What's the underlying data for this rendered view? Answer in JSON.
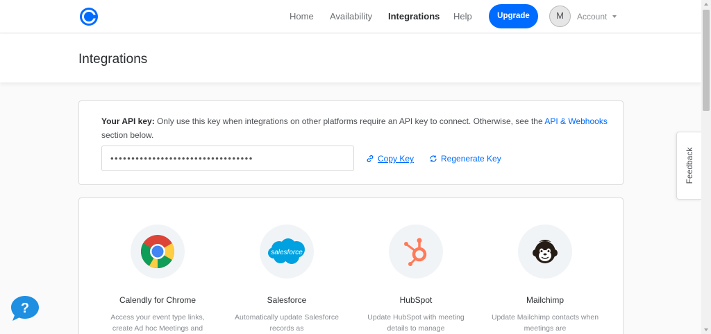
{
  "nav": {
    "links": [
      {
        "label": "Home",
        "active": false
      },
      {
        "label": "Availability",
        "active": false
      },
      {
        "label": "Integrations",
        "active": true
      },
      {
        "label": "Help",
        "active": false
      }
    ],
    "upgrade_label": "Upgrade",
    "avatar_initial": "M",
    "account_label": "Account"
  },
  "page": {
    "title": "Integrations"
  },
  "api": {
    "label": "Your API key:",
    "text_before_link": " Only use this key when integrations on other platforms require an API key to connect. Otherwise, see the ",
    "link_text": "API & Webhooks",
    "text_after_link": " section below.",
    "key_masked": "••••••••••••••••••••••••••••••••••",
    "copy_label": "Copy Key",
    "regenerate_label": "Regenerate Key"
  },
  "integrations": [
    {
      "name": "Calendly for Chrome",
      "desc": "Access your event type links, create Ad hoc Meetings and",
      "icon": "chrome-icon"
    },
    {
      "name": "Salesforce",
      "desc": "Automatically update Salesforce records as",
      "icon": "salesforce-icon",
      "logo_text": "salesforce"
    },
    {
      "name": "HubSpot",
      "desc": "Update HubSpot with meeting details to manage",
      "icon": "hubspot-icon"
    },
    {
      "name": "Mailchimp",
      "desc": "Update Mailchimp contacts when meetings are",
      "icon": "mailchimp-icon"
    }
  ],
  "feedback_label": "Feedback",
  "help_bubble_label": "?",
  "colors": {
    "brand_blue": "#006bff",
    "text_dark": "#2a2d30",
    "muted": "#8a8e93"
  }
}
